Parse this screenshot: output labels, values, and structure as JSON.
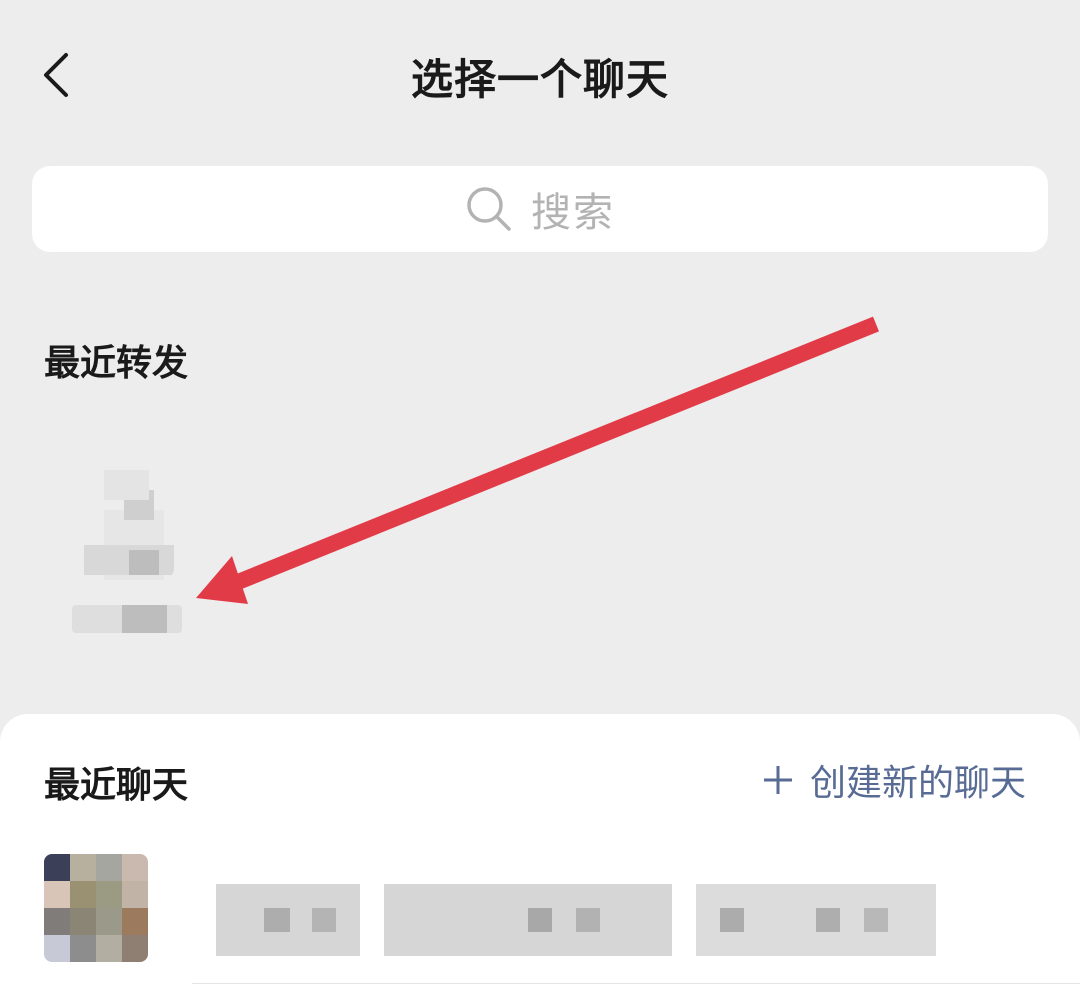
{
  "header": {
    "title": "选择一个聊天",
    "back_icon": "chevron-left-icon"
  },
  "search": {
    "placeholder": "搜索",
    "icon": "search-icon"
  },
  "recent_forward": {
    "title": "最近转发"
  },
  "recent_chats": {
    "title": "最近聊天",
    "create_label": "创建新的聊天",
    "create_icon": "plus-icon"
  },
  "colors": {
    "background": "#ededed",
    "link": "#576b95",
    "arrow": "#e23b48",
    "placeholder": "#b3b3b3"
  }
}
